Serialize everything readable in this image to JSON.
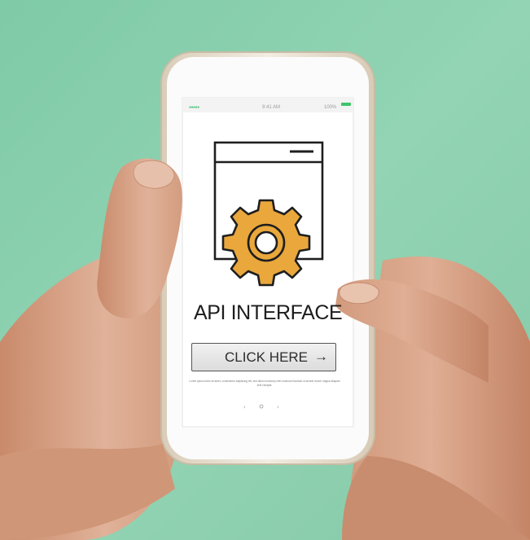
{
  "status_bar": {
    "signal_dots": "●●●●●",
    "time": "9:41 AM",
    "battery_percent": "100%",
    "battery_level": 1.0
  },
  "app_screen": {
    "illustration": [
      "window-icon",
      "gear-icon"
    ],
    "title": "API INTERFACE",
    "button_label": "CLICK HERE",
    "button_icon": "arrow-right-icon",
    "body_text": "Lorem ipsum dolor sit amet, consectetur adipiscing elit, sed diam nonummy nibh euismod tincidunt ut laoreet dolore magna aliquam erat volutpat.",
    "pagination": [
      "‹",
      "◦",
      "›"
    ]
  },
  "colors": {
    "background": "#8fd0b0",
    "phone_frame": "#e8e0d2",
    "screen": "#ffffff",
    "gear": "#e9a73c",
    "outline": "#1e1e1e",
    "button_fill": "#e2e2e2",
    "battery": "#3ec56b",
    "skin": "#d9a88a"
  }
}
